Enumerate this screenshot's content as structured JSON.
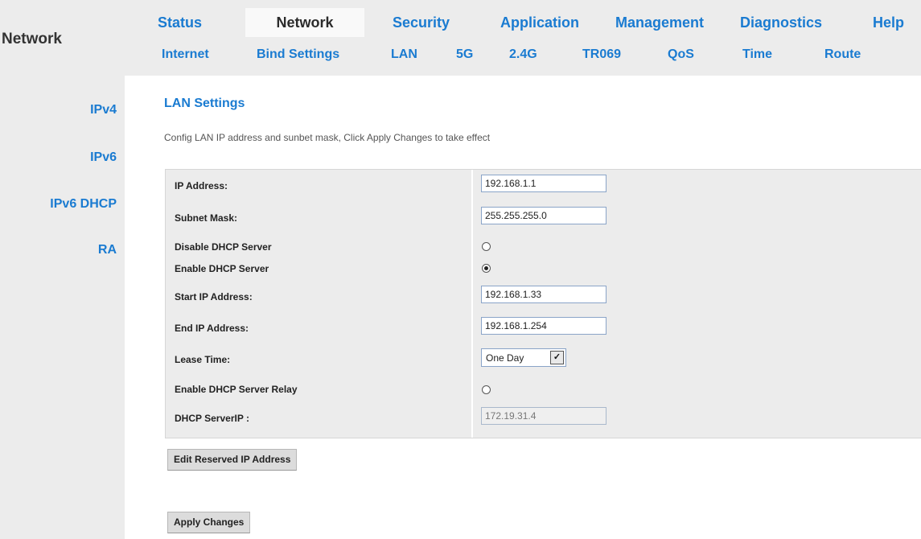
{
  "app": {
    "section_title": "Network"
  },
  "main_nav": [
    {
      "label": "Status",
      "active": false
    },
    {
      "label": "Network",
      "active": true
    },
    {
      "label": "Security",
      "active": false
    },
    {
      "label": "Application",
      "active": false
    },
    {
      "label": "Management",
      "active": false
    },
    {
      "label": "Diagnostics",
      "active": false
    },
    {
      "label": "Help",
      "active": false
    }
  ],
  "sub_nav": [
    {
      "label": "Internet"
    },
    {
      "label": "Bind Settings"
    },
    {
      "label": "LAN"
    },
    {
      "label": "5G"
    },
    {
      "label": "2.4G"
    },
    {
      "label": "TR069"
    },
    {
      "label": "QoS"
    },
    {
      "label": "Time"
    },
    {
      "label": "Route"
    }
  ],
  "sidebar": {
    "items": [
      {
        "label": "IPv4"
      },
      {
        "label": "IPv6"
      },
      {
        "label": "IPv6 DHCP"
      },
      {
        "label": "RA"
      }
    ]
  },
  "page": {
    "title": "LAN Settings",
    "description": "Config LAN IP address and sunbet mask, Click Apply Changes to take effect"
  },
  "form": {
    "ip_address": {
      "label": "IP Address:",
      "value": "192.168.1.1"
    },
    "subnet_mask": {
      "label": "Subnet Mask:",
      "value": "255.255.255.0"
    },
    "disable_dhcp": {
      "label": "Disable DHCP Server",
      "checked": false
    },
    "enable_dhcp": {
      "label": "Enable DHCP Server",
      "checked": true
    },
    "start_ip": {
      "label": "Start IP Address:",
      "value": "192.168.1.33"
    },
    "end_ip": {
      "label": "End IP Address:",
      "value": "192.168.1.254"
    },
    "lease_time": {
      "label": "Lease Time:",
      "value": "One Day"
    },
    "dhcp_relay": {
      "label": "Enable DHCP Server Relay",
      "checked": false
    },
    "dhcp_server_ip": {
      "label": "DHCP ServerIP :",
      "value": "172.19.31.4",
      "disabled": true
    }
  },
  "buttons": {
    "edit_reserved": "Edit Reserved IP  Address",
    "apply": "Apply Changes"
  },
  "colors": {
    "accent": "#1a7bd1",
    "panel_bg": "#ececec"
  }
}
